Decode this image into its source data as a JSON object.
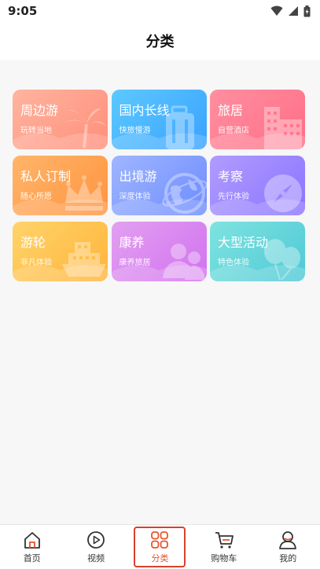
{
  "status": {
    "time": "9:05"
  },
  "header": {
    "title": "分类"
  },
  "categories": [
    {
      "title": "周边游",
      "subtitle": "玩转当地",
      "icon": "palm-tree-icon",
      "colors": [
        "#ffb4a0",
        "#ff8f7a"
      ]
    },
    {
      "title": "国内长线",
      "subtitle": "快旅慢游",
      "icon": "suitcase-icon",
      "colors": [
        "#5cc9ff",
        "#3aa2ff"
      ]
    },
    {
      "title": "旅居",
      "subtitle": "自营酒店",
      "icon": "building-icon",
      "colors": [
        "#ff8fa0",
        "#ff6e86"
      ]
    },
    {
      "title": "私人订制",
      "subtitle": "随心所愿",
      "icon": "crown-icon",
      "colors": [
        "#ffb56a",
        "#ff9440"
      ]
    },
    {
      "title": "出境游",
      "subtitle": "深度体验",
      "icon": "globe-icon",
      "colors": [
        "#9fb6ff",
        "#6e8cff"
      ]
    },
    {
      "title": "考察",
      "subtitle": "先行体验",
      "icon": "compass-icon",
      "colors": [
        "#b09cff",
        "#8c74ff"
      ]
    },
    {
      "title": "游轮",
      "subtitle": "非凡体验",
      "icon": "ship-icon",
      "colors": [
        "#ffd36a",
        "#ffb53c"
      ]
    },
    {
      "title": "康养",
      "subtitle": "康养旅居",
      "icon": "people-icon",
      "colors": [
        "#e2a0f0",
        "#d272f0"
      ]
    },
    {
      "title": "大型活动",
      "subtitle": "特色体验",
      "icon": "balloon-icon",
      "colors": [
        "#7fe3e0",
        "#4fc9d6"
      ]
    }
  ],
  "tabbar": {
    "items": [
      {
        "label": "首页",
        "icon": "home-icon",
        "active": false
      },
      {
        "label": "视频",
        "icon": "video-icon",
        "active": false
      },
      {
        "label": "分类",
        "icon": "category-icon",
        "active": true
      },
      {
        "label": "购物车",
        "icon": "cart-icon",
        "active": false
      },
      {
        "label": "我的",
        "icon": "user-icon",
        "active": false
      }
    ],
    "active_color": "#e8542c"
  }
}
